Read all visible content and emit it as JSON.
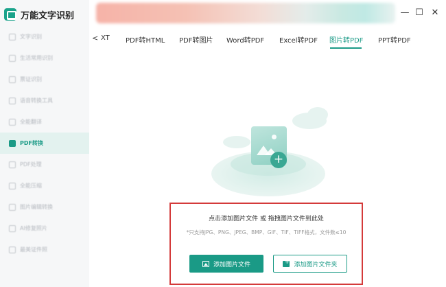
{
  "app": {
    "title": "万能文字识别"
  },
  "sidebar": {
    "items": [
      {
        "label": "文字识别",
        "icon": "text-scan-icon",
        "active": false
      },
      {
        "label": "生活常用识别",
        "icon": "life-scan-icon",
        "active": false
      },
      {
        "label": "票证识别",
        "icon": "ticket-icon",
        "active": false
      },
      {
        "label": "语音转换工具",
        "icon": "voice-icon",
        "active": false
      },
      {
        "label": "全能翻译",
        "icon": "translate-icon",
        "active": false
      },
      {
        "label": "PDF转换",
        "icon": "pdf-convert-icon",
        "active": true
      },
      {
        "label": "PDF处理",
        "icon": "pdf-process-icon",
        "active": false
      },
      {
        "label": "全能压缩",
        "icon": "compress-icon",
        "active": false
      },
      {
        "label": "图片编辑转换",
        "icon": "image-edit-icon",
        "active": false
      },
      {
        "label": "AI修复照片",
        "icon": "ai-repair-icon",
        "active": false
      },
      {
        "label": "最美证件照",
        "icon": "id-photo-icon",
        "active": false
      }
    ]
  },
  "window_controls": {
    "minimize": "—",
    "maximize": "☐",
    "close": "✕"
  },
  "tabs": {
    "back_label": "<",
    "items": [
      {
        "label": "XT",
        "active": false
      },
      {
        "label": "PDF转HTML",
        "active": false
      },
      {
        "label": "PDF转图片",
        "active": false
      },
      {
        "label": "Word转PDF",
        "active": false
      },
      {
        "label": "Excel转PDF",
        "active": false
      },
      {
        "label": "图片转PDF",
        "active": true
      },
      {
        "label": "PPT转PDF",
        "active": false
      }
    ]
  },
  "upload": {
    "main_text": "点击添加图片文件 或 拖拽图片文件到此处",
    "hint_text": "*只支持JPG、PNG、JPEG、BMP、GIF、TIF、TIFF格式，文件数≤10",
    "add_file_label": "添加图片文件",
    "add_folder_label": "添加图片文件夹"
  },
  "colors": {
    "accent": "#1a9a86",
    "highlight_border": "#d43a3a"
  }
}
